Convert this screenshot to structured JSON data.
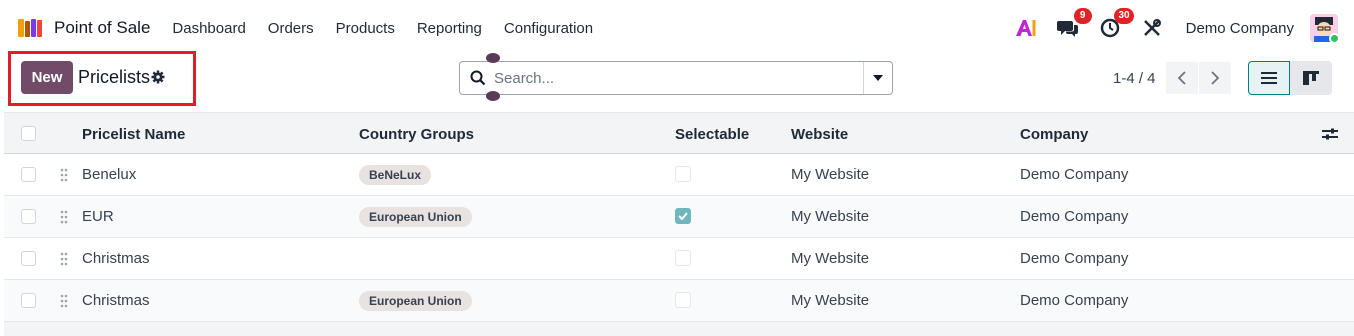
{
  "navbar": {
    "app_name": "Point of Sale",
    "menu": [
      "Dashboard",
      "Orders",
      "Products",
      "Reporting",
      "Configuration"
    ],
    "messages_badge": "9",
    "activities_badge": "30",
    "company": "Demo Company",
    "icons": [
      "app-books-icon",
      "ai-icon",
      "chat-icon",
      "clock-icon",
      "tools-icon",
      "avatar"
    ]
  },
  "control_panel": {
    "new_label": "New",
    "title": "Pricelists",
    "search_placeholder": "Search...",
    "pager": "1-4 / 4",
    "highlight_color": "#e11d2a",
    "accent_color": "#714b67"
  },
  "table": {
    "columns": [
      "Pricelist Name",
      "Country Groups",
      "Selectable",
      "Website",
      "Company"
    ],
    "rows": [
      {
        "name": "Benelux",
        "country_group": "BeNeLux",
        "selectable": false,
        "website": "My Website",
        "company": "Demo Company"
      },
      {
        "name": "EUR",
        "country_group": "European Union",
        "selectable": true,
        "website": "My Website",
        "company": "Demo Company"
      },
      {
        "name": "Christmas",
        "country_group": "",
        "selectable": false,
        "website": "My Website",
        "company": "Demo Company"
      },
      {
        "name": "Christmas",
        "country_group": "European Union",
        "selectable": false,
        "website": "My Website",
        "company": "Demo Company"
      }
    ]
  }
}
